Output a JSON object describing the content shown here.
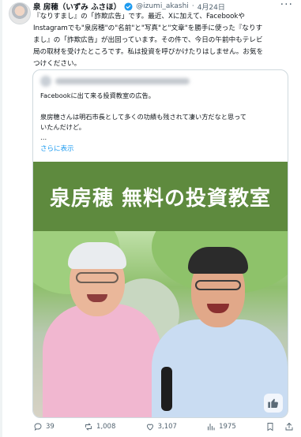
{
  "author": {
    "display_name": "泉 房穂（いずみ ふさほ）",
    "handle": "@izumi_akashi",
    "separator": "·",
    "date": "4月24日"
  },
  "post_text": [
    "『なりすまし』の「詐欺広告」です。最近、Xに加えて、Facebookや",
    "Instagramでも\"泉房穂\"の\"名前\"と\"写真\"と\"文章\"を勝手に使った『なりす",
    "まし』の「詐欺広告」が出回っています。その件で、今日の午前中もテレビ",
    "局の取材を受けたところです。私は投資を呼びかけたりはしません。お気を",
    "つけください。"
  ],
  "quoted": {
    "line1": "Facebookに出て来る投資教室の広告。",
    "line2": "泉房穂さんは明石市長として多くの功績も残されて凄い方だなと思って",
    "line3": "いたんだけど。",
    "ellipsis": "…",
    "show_more": "さらに表示"
  },
  "banner": {
    "title": "泉房穂 無料の投資教室",
    "color": "#5e8a3e"
  },
  "actions": {
    "replies": "39",
    "reposts": "1,008",
    "likes": "3,107",
    "views": "1975"
  },
  "icons": [
    "verified-badge-icon",
    "more-icon",
    "reply-icon",
    "repost-icon",
    "like-icon",
    "views-icon",
    "bookmark-icon",
    "share-icon",
    "thumbs-up-icon"
  ],
  "colors": {
    "accent": "#1d9bf0",
    "muted": "#536471",
    "border": "#cfd9de"
  }
}
